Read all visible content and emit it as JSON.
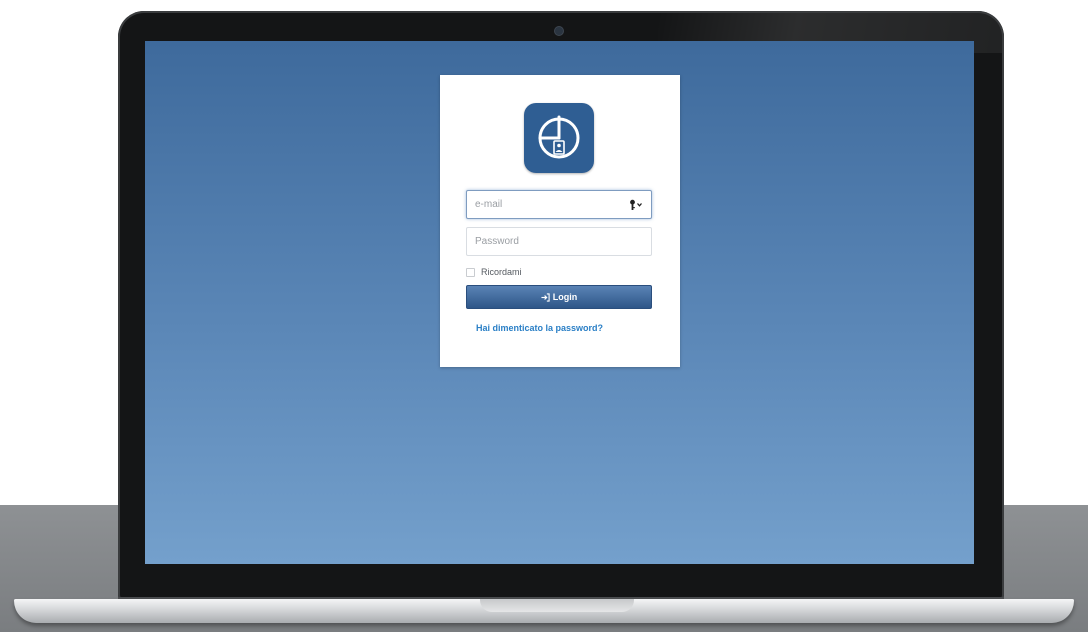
{
  "login": {
    "email_placeholder": "e-mail",
    "password_placeholder": "Password",
    "remember_label": "Ricordami",
    "login_label": "Login",
    "forgot_password": "Hai dimenticato la password?"
  },
  "icons": {
    "logo": "clock-badge-icon",
    "email_field": "key-icon",
    "login_button": "sign-in-icon"
  },
  "colors": {
    "screen_top": "#3e6a9c",
    "screen_bottom": "#74a0cc",
    "logo_background": "#2f5e93",
    "button_top": "#5a83b5",
    "button_bottom": "#2e5688",
    "link": "#2a7fc6"
  }
}
